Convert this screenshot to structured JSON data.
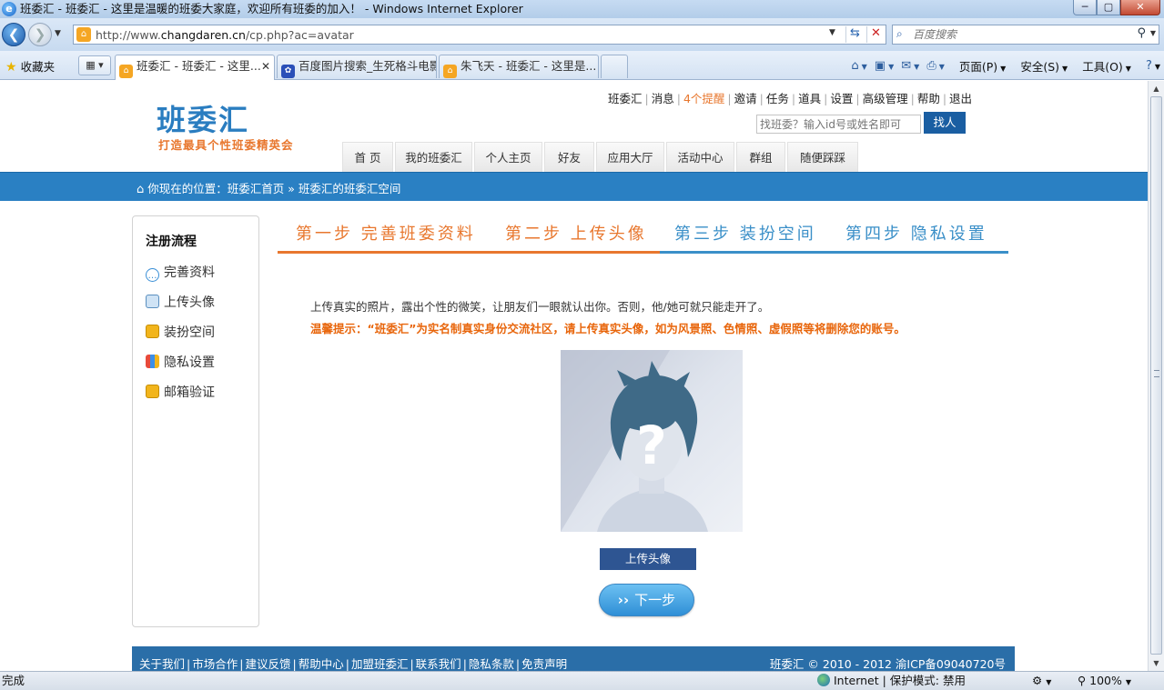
{
  "window": {
    "title": "班委汇 - 班委汇 - 这里是温暖的班委大家庭，欢迎所有班委的加入！ - Windows Internet Explorer",
    "min": "─",
    "max": "▢",
    "close": "✕"
  },
  "address": {
    "url_prefix": "http://www.",
    "url_domain": "changdaren.cn",
    "url_path": "/cp.php?ac=avatar",
    "search_placeholder": "百度搜索"
  },
  "tabs": {
    "favorites_label": "收藏夹",
    "items": [
      {
        "label": "班委汇 - 班委汇 - 这里...",
        "active": true
      },
      {
        "label": "百度图片搜索_生死格斗电影",
        "active": false
      },
      {
        "label": "朱飞天 - 班委汇 - 这里是...",
        "active": false
      }
    ]
  },
  "commandbar": {
    "page": "页面(P)",
    "safety": "安全(S)",
    "tools": "工具(O)",
    "help": "?"
  },
  "site": {
    "logo": "班委汇",
    "slogan": "打造最具个性班委精英会",
    "toplinks": [
      "班委汇",
      "消息",
      "4个提醒",
      "邀请",
      "任务",
      "道具",
      "设置",
      "高级管理",
      "帮助",
      "退出"
    ],
    "search_placeholder": "找班委？输入id号或姓名即可",
    "search_button": "找人",
    "nav": [
      "首 页",
      "我的班委汇",
      "个人主页",
      "好友",
      "应用大厅",
      "活动中心",
      "群组",
      "随便踩踩"
    ],
    "breadcrumb": "你现在的位置：班委汇首页 » 班委汇的班委汇空间"
  },
  "sidebar": {
    "title": "注册流程",
    "items": [
      "完善资料",
      "上传头像",
      "装扮空间",
      "隐私设置",
      "邮箱验证"
    ]
  },
  "steps": [
    {
      "label": "第一步 完善班委资料",
      "state": "done"
    },
    {
      "label": "第二步 上传头像",
      "state": "current"
    },
    {
      "label": "第三步 装扮空间",
      "state": "todo"
    },
    {
      "label": "第四步 隐私设置",
      "state": "todo"
    }
  ],
  "content": {
    "intro": "上传真实的照片，露出个性的微笑，让朋友们一眼就认出你。否则，他/她可就只能走开了。",
    "warning": "温馨提示：“班委汇”为实名制真实身份交流社区，请上传真实头像，如为风景照、色情照、虚假照等将删除您的账号。",
    "upload_button": "上传头像",
    "next_button": "下一步"
  },
  "footer": {
    "links": [
      "关于我们",
      "市场合作",
      "建议反馈",
      "帮助中心",
      "加盟班委汇",
      "联系我们",
      "隐私条款",
      "免责声明"
    ],
    "copyright": "班委汇 © 2010 - 2012 渝ICP备09040720号"
  },
  "status": {
    "text": "完成",
    "zone": "Internet | 保护模式: 禁用",
    "zoom": "100%"
  },
  "colors": {
    "accent_orange": "#e8772e",
    "accent_blue": "#2a80c3",
    "footer_blue": "#2a6ea8"
  }
}
